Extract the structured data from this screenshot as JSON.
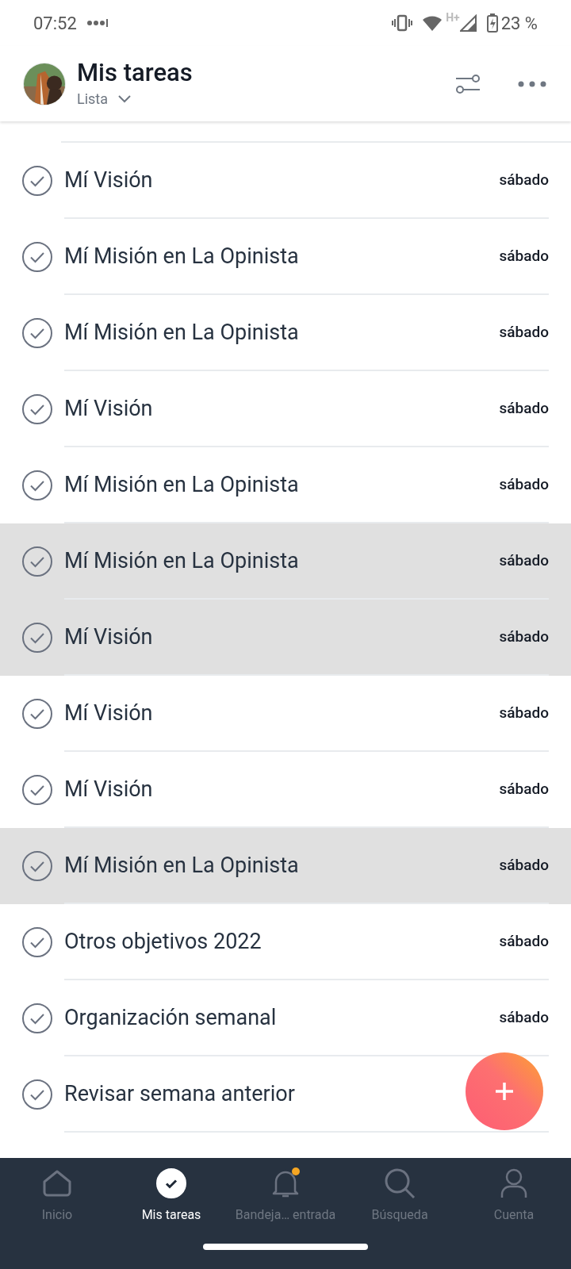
{
  "status_bar": {
    "time": "07:52",
    "network": "H+",
    "battery": "23 %"
  },
  "header": {
    "title": "Mis tareas",
    "view": "Lista"
  },
  "tasks": [
    {
      "title": "Mí Visión",
      "date": "sábado",
      "selected": false
    },
    {
      "title": "Mí Misión en La Opinista",
      "date": "sábado",
      "selected": false
    },
    {
      "title": "Mí Misión en La Opinista",
      "date": "sábado",
      "selected": false
    },
    {
      "title": "Mí Visión",
      "date": "sábado",
      "selected": false
    },
    {
      "title": "Mí Misión en La Opinista",
      "date": "sábado",
      "selected": false
    },
    {
      "title": "Mí Misión en La Opinista",
      "date": "sábado",
      "selected": true
    },
    {
      "title": "Mí Visión",
      "date": "sábado",
      "selected": true
    },
    {
      "title": "Mí Visión",
      "date": "sábado",
      "selected": false
    },
    {
      "title": "Mí Visión",
      "date": "sábado",
      "selected": false
    },
    {
      "title": "Mí Misión en La Opinista",
      "date": "sábado",
      "selected": true
    },
    {
      "title": "Otros objetivos 2022",
      "date": "sábado",
      "selected": false
    },
    {
      "title": "Organización semanal",
      "date": "sábado",
      "selected": false
    },
    {
      "title": "Revisar semana anterior",
      "selected": false
    }
  ],
  "bottom_nav": [
    {
      "kind": "home",
      "label": "Inicio",
      "selected": false,
      "badge": false
    },
    {
      "kind": "tasks",
      "label": "Mis tareas",
      "selected": true,
      "badge": false
    },
    {
      "kind": "inbox",
      "label": "Bandeja… entrada",
      "selected": false,
      "badge": true
    },
    {
      "kind": "search",
      "label": "Búsqueda",
      "selected": false,
      "badge": false
    },
    {
      "kind": "account",
      "label": "Cuenta",
      "selected": false,
      "badge": false
    }
  ]
}
